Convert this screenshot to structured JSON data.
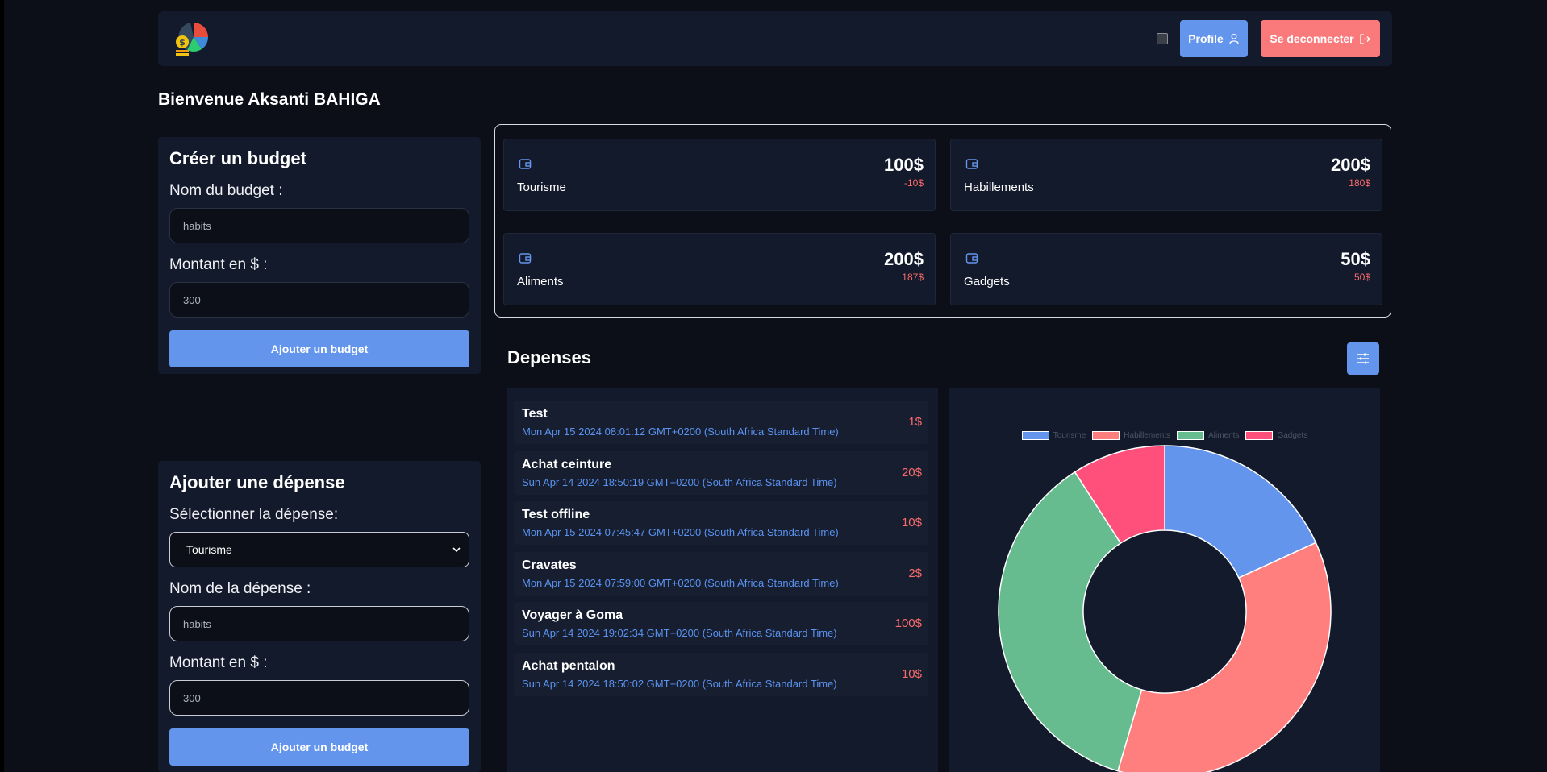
{
  "navbar": {
    "profile_label": "Profile",
    "logout_label": "Se deconnecter"
  },
  "welcome": "Bienvenue Aksanti BAHIGA",
  "create_budget": {
    "title": "Créer un budget",
    "name_label": "Nom du budget :",
    "name_placeholder": "habits",
    "amount_label": "Montant en $ :",
    "amount_placeholder": "300",
    "submit_label": "Ajouter un budget"
  },
  "add_expense": {
    "title": "Ajouter une dépense",
    "select_label": "Sélectionner la dépense:",
    "select_value": "Tourisme",
    "name_label": "Nom de la dépense :",
    "name_placeholder": "habits",
    "amount_label": "Montant en $ :",
    "amount_placeholder": "300",
    "submit_label": "Ajouter un budget"
  },
  "budgets": [
    {
      "name": "Tourisme",
      "amount": "100$",
      "remaining": "-10$"
    },
    {
      "name": "Habillements",
      "amount": "200$",
      "remaining": "180$"
    },
    {
      "name": "Aliments",
      "amount": "200$",
      "remaining": "187$"
    },
    {
      "name": "Gadgets",
      "amount": "50$",
      "remaining": "50$"
    }
  ],
  "expenses_title": "Depenses",
  "expenses": [
    {
      "name": "Test",
      "date": "Mon Apr 15 2024 08:01:12 GMT+0200 (South Africa Standard Time)",
      "amount": "1$"
    },
    {
      "name": "Achat ceinture",
      "date": "Sun Apr 14 2024 18:50:19 GMT+0200 (South Africa Standard Time)",
      "amount": "20$"
    },
    {
      "name": "Test offline",
      "date": "Mon Apr 15 2024 07:45:47 GMT+0200 (South Africa Standard Time)",
      "amount": "10$"
    },
    {
      "name": "Cravates",
      "date": "Mon Apr 15 2024 07:59:00 GMT+0200 (South Africa Standard Time)",
      "amount": "2$"
    },
    {
      "name": "Voyager à Goma",
      "date": "Sun Apr 14 2024 19:02:34 GMT+0200 (South Africa Standard Time)",
      "amount": "100$"
    },
    {
      "name": "Achat pentalon",
      "date": "Sun Apr 14 2024 18:50:02 GMT+0200 (South Africa Standard Time)",
      "amount": "10$"
    }
  ],
  "chart_data": {
    "type": "pie",
    "categories": [
      "Tourisme",
      "Habillements",
      "Aliments",
      "Gadgets"
    ],
    "values": [
      100,
      200,
      200,
      50
    ],
    "colors": [
      "#6495ed",
      "#ff7f7f",
      "#66bb8f",
      "#ff4f7b"
    ]
  },
  "colors": {
    "primary": "#6495ed",
    "danger": "#fa7a7c",
    "panel": "#131a2b",
    "background": "#0c0f17"
  }
}
